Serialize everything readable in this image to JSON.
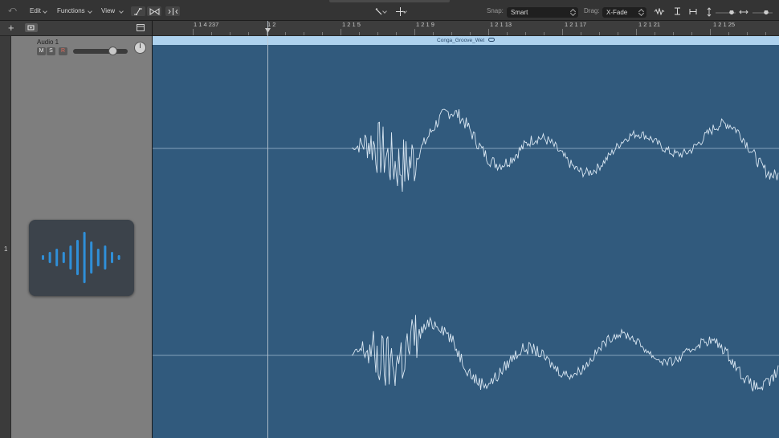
{
  "toolbar": {
    "back_icon": "undo-arrow-icon",
    "menus": [
      "Edit",
      "Functions",
      "View"
    ],
    "snap_label": "Snap:",
    "snap_value": "Smart",
    "drag_label": "Drag:",
    "drag_value": "X-Fade"
  },
  "ruler": {
    "labels": [
      "1 1 4 237",
      "1 2",
      "1 2 1 5",
      "1 2 1 9",
      "1 2 1 13",
      "1 2 1 17",
      "1 2 1 21",
      "1 2 1 25"
    ]
  },
  "track": {
    "number": "1",
    "name": "Audio 1",
    "mute": "M",
    "solo": "S",
    "record": "R",
    "volume_level": 0.73
  },
  "region": {
    "name": "Conga_Groove_Wet"
  },
  "colors": {
    "arrange_bg": "#315a7d",
    "region_header": "#aed2ee",
    "waveform": "#d8e6f2",
    "icon_bars": "#2f8fd8"
  }
}
